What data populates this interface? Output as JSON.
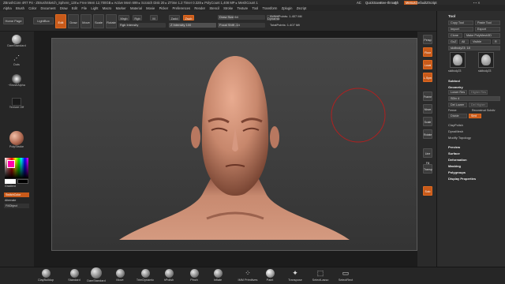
{
  "titlebar": {
    "title": "ZBrushCore 4R7 P4 - ZBrushSketch_Sphere_128 ▸ Free Mem 12,700GB ▸ Active Mem 699 ▸ Scratch Disk 20 ▸ ZTime 1.2 Timer 0.328 ▸ PolyCount 1,408 MP ▸ MeshCount 1",
    "right_items": [
      "AC",
      "QuickSave",
      "See-through",
      "0",
      "Menus",
      "DefaultZScript"
    ]
  },
  "menu": {
    "items": [
      "Alpha",
      "Brush",
      "Color",
      "Document",
      "Draw",
      "Edit",
      "File",
      "Light",
      "Macro",
      "Marker",
      "Material",
      "Movie",
      "Picker",
      "Preferences",
      "Render",
      "Stencil",
      "Stroke",
      "Texture",
      "Tool",
      "Transform",
      "Zplugin",
      "Zscript"
    ]
  },
  "topshelf": {
    "home_page": "Home Page",
    "lightbox": "LightBox",
    "edit": "Edit",
    "draw": "Draw",
    "move": "Move",
    "scale": "Scale",
    "rotate": "Rotate",
    "mrgb": "Mrgb",
    "rgb": "Rgb",
    "m": "M",
    "zadd": "Zadd",
    "zsub": "Zsub",
    "rgb_intensity": "Rgb Intensity",
    "z_intensity": "Z Intensity 100",
    "draw_size": "Draw Size 64",
    "focal_shift": "Focal Shift -14",
    "dynamic": "Dynamic",
    "active_points": "ActivePoints: 1.407 Mil",
    "total_points": "TotalPoints: 1.407 Mil"
  },
  "leftbar": {
    "items": [
      "DamStandard",
      "Dots",
      "~BrushAlpha",
      "Texture Off",
      "PolyStroke",
      "Gradient",
      "SwitchColor",
      "Alternate",
      "FillObject"
    ]
  },
  "rightbar": {
    "items": [
      "Persp",
      "Floor",
      "Local",
      "L.Sym",
      "Frame",
      "Move",
      "Scale",
      "Rotate",
      "Line Fill",
      "Transp",
      "Solo"
    ]
  },
  "tray": {
    "title": "Tool",
    "buttons": [
      "Copy Tool",
      "Paste Tool",
      "Import",
      "Export",
      "Clone",
      "Make PolyMesh3D",
      "GoZ",
      "All",
      "Visible",
      "R"
    ],
    "tool_slider": "skdbody23: 18",
    "tool_names": [
      "skdbody23",
      "skdbody23"
    ],
    "sections": [
      "Subtool",
      "Geometry",
      "Lower Res",
      "Higher Res",
      "SDiv 4",
      "Del Lower",
      "Del Higher",
      "Freeze",
      "Reconstruct Subdiv",
      "Divide",
      "Smt",
      "ClayPolish",
      "DynaMesh",
      "Modify Topology",
      "Preview",
      "Surface",
      "Deformation",
      "Masking",
      "Polygroups",
      "Display Properties"
    ]
  },
  "bottom": {
    "brushes": [
      "ClayBuildup",
      "Standard",
      "DamStandard",
      "Move",
      "TrimDynamic",
      "hPolish",
      "Pinch",
      "Inflate",
      "IMM Primitives",
      "Paint",
      "Transpose",
      "SelectLasso",
      "SelectRect"
    ]
  },
  "colors": {
    "accent": "#c85a1a",
    "skin": "#c98b72",
    "background": "#444444"
  }
}
